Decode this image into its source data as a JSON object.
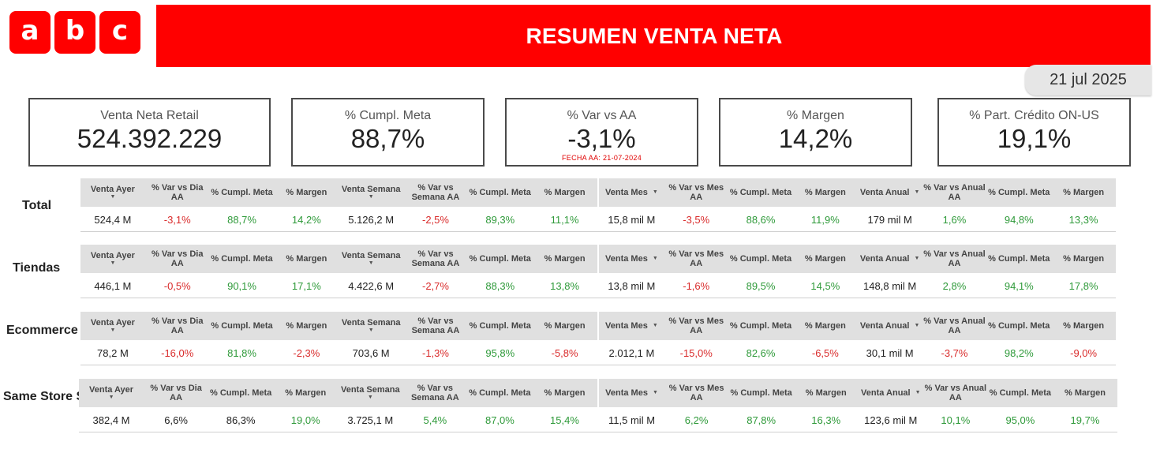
{
  "logo": {
    "letters": [
      "a",
      "b",
      "c"
    ],
    "color": "#ff0000"
  },
  "header": {
    "title": "RESUMEN VENTA NETA",
    "color": "#ff0000"
  },
  "date": "21 jul 2025",
  "kpis": [
    {
      "label": "Venta Neta Retail",
      "value": "524.392.229"
    },
    {
      "label": "% Cumpl. Meta",
      "value": "88,7%"
    },
    {
      "label": "% Var vs AA",
      "value": "-3,1%",
      "note": "FECHA AA: 21-07-2024"
    },
    {
      "label": "% Margen",
      "value": "14,2%"
    },
    {
      "label": "% Part. Crédito ON-US",
      "value": "19,1%"
    }
  ],
  "colors": {
    "negative": "#d92b2b",
    "positive": "#2f9a3a",
    "header_bg": "#e0e0e0"
  },
  "sections": [
    {
      "label": "Total",
      "headers": [
        "Venta Ayer",
        "% Var vs Dia AA",
        "% Cumpl. Meta",
        "% Margen",
        "Venta Semana",
        "% Var vs Semana AA",
        "% Cumpl. Meta",
        "% Margen",
        "Venta Mes",
        "% Var vs Mes AA",
        "% Cumpl. Meta",
        "% Margen",
        "Venta Anual",
        "% Var vs Anual AA",
        "% Cumpl. Meta",
        "% Margen"
      ],
      "values": [
        "524,4 M",
        "-3,1%",
        "88,7%",
        "14,2%",
        "5.126,2 M",
        "-2,5%",
        "89,3%",
        "11,1%",
        "15,8 mil M",
        "-3,5%",
        "88,6%",
        "11,9%",
        "179 mil M",
        "1,6%",
        "94,8%",
        "13,3%"
      ],
      "tones": [
        "neu",
        "neg",
        "pos",
        "pos",
        "neu",
        "neg",
        "pos",
        "pos",
        "neu",
        "neg",
        "pos",
        "pos",
        "neu",
        "pos",
        "pos",
        "pos"
      ]
    },
    {
      "label": "Tiendas",
      "headers": [
        "Venta Ayer",
        "% Var vs Dia AA",
        "% Cumpl. Meta",
        "% Margen",
        "Venta Semana",
        "% Var vs Semana AA",
        "% Cumpl. Meta",
        "% Margen",
        "Venta Mes",
        "% Var vs Mes AA",
        "% Cumpl. Meta",
        "% Margen",
        "Venta Anual",
        "% Var vs Anual AA",
        "% Cumpl. Meta",
        "% Margen"
      ],
      "values": [
        "446,1 M",
        "-0,5%",
        "90,1%",
        "17,1%",
        "4.422,6 M",
        "-2,7%",
        "88,3%",
        "13,8%",
        "13,8 mil M",
        "-1,6%",
        "89,5%",
        "14,5%",
        "148,8 mil M",
        "2,8%",
        "94,1%",
        "17,8%"
      ],
      "tones": [
        "neu",
        "neg",
        "pos",
        "pos",
        "neu",
        "neg",
        "pos",
        "pos",
        "neu",
        "neg",
        "pos",
        "pos",
        "neu",
        "pos",
        "pos",
        "pos"
      ]
    },
    {
      "label": "Ecommerce",
      "headers": [
        "Venta Ayer",
        "% Var vs Dia AA",
        "% Cumpl. Meta",
        "% Margen",
        "Venta Semana",
        "% Var vs Semana AA",
        "% Cumpl. Meta",
        "% Margen",
        "Venta Mes",
        "% Var vs Mes AA",
        "% Cumpl. Meta",
        "% Margen",
        "Venta Anual",
        "% Var vs Anual AA",
        "% Cumpl. Meta",
        "% Margen"
      ],
      "values": [
        "78,2 M",
        "-16,0%",
        "81,8%",
        "-2,3%",
        "703,6 M",
        "-1,3%",
        "95,8%",
        "-5,8%",
        "2.012,1 M",
        "-15,0%",
        "82,6%",
        "-6,5%",
        "30,1 mil M",
        "-3,7%",
        "98,2%",
        "-9,0%"
      ],
      "tones": [
        "neu",
        "neg",
        "pos",
        "neg",
        "neu",
        "neg",
        "pos",
        "neg",
        "neu",
        "neg",
        "pos",
        "neg",
        "neu",
        "neg",
        "pos",
        "neg"
      ]
    },
    {
      "label": "Same Store Sales (SSS)",
      "headers": [
        "Venta Ayer",
        "% Var vs Dia AA",
        "% Cumpl. Meta",
        "% Margen",
        "Venta Semana",
        "% Var vs Semana AA",
        "% Cumpl. Meta",
        "% Margen",
        "Venta Mes",
        "% Var vs Mes AA",
        "% Cumpl. Meta",
        "% Margen",
        "Venta Anual",
        "% Var vs Anual AA",
        "% Cumpl. Meta",
        "% Margen"
      ],
      "values": [
        "382,4 M",
        "6,6%",
        "86,3%",
        "19,0%",
        "3.725,1 M",
        "5,4%",
        "87,0%",
        "15,4%",
        "11,5 mil M",
        "6,2%",
        "87,8%",
        "16,3%",
        "123,6 mil M",
        "10,1%",
        "95,0%",
        "19,7%"
      ],
      "tones": [
        "neu",
        "neu",
        "neu",
        "pos",
        "neu",
        "pos",
        "pos",
        "pos",
        "neu",
        "pos",
        "pos",
        "pos",
        "neu",
        "pos",
        "pos",
        "pos"
      ]
    }
  ]
}
